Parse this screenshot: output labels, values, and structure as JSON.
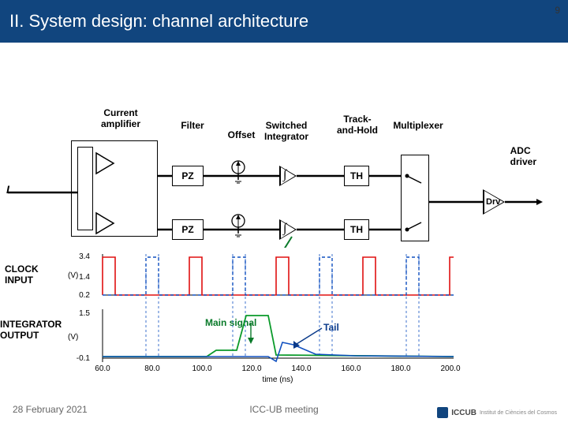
{
  "slide_number": "9",
  "title": "II. System design: channel architecture",
  "diagram": {
    "input_label": "I",
    "stages": {
      "amp": "Current\namplifier",
      "filter": "Filter",
      "offset": "Offset",
      "integrator": "Switched\nIntegrator",
      "trackhold": "Track-\nand-Hold",
      "mux": "Multiplexer"
    },
    "blocks": {
      "pz": "PZ",
      "th": "TH",
      "drv": "Drv"
    },
    "integral_symbol": "∫",
    "adc_driver": "ADC\ndriver"
  },
  "plots": {
    "clock_label": "CLOCK\nINPUT",
    "integrator_label": "INTEGRATOR\nOUTPUT",
    "main_signal_label": "Main signal",
    "tail_label": "Tail",
    "x_axis_label": "time (ns)",
    "x_ticks": [
      "60.0",
      "80.0",
      "100.0",
      "120.0",
      "140.0",
      "160.0",
      "180.0",
      "200.0"
    ],
    "y_ticks_upper": [
      "0.2",
      "1.4",
      "3.4"
    ],
    "y_ticks_lower": [
      "-0.1",
      "1.5"
    ],
    "y_unit": "(V)"
  },
  "chart_data": [
    {
      "type": "line",
      "title": "CLOCK INPUT",
      "xlabel": "time (ns)",
      "ylabel": "(V)",
      "ylim": [
        0.2,
        3.4
      ],
      "xlim": [
        60,
        200
      ],
      "series": [
        {
          "name": "clock_red",
          "x": [
            60,
            60,
            65,
            65,
            95,
            95,
            100,
            100,
            130,
            130,
            135,
            135,
            165,
            165,
            170,
            170,
            200
          ],
          "y": [
            0.2,
            3.4,
            3.4,
            0.2,
            0.2,
            3.4,
            3.4,
            0.2,
            0.2,
            3.4,
            3.4,
            0.2,
            0.2,
            3.4,
            3.4,
            0.2,
            0.2
          ]
        },
        {
          "name": "clock_blue_dashed",
          "x": [
            60,
            78,
            78,
            83,
            83,
            113,
            113,
            118,
            118,
            148,
            148,
            153,
            153,
            183,
            183,
            188,
            188,
            200
          ],
          "y": [
            0.2,
            0.2,
            3.4,
            3.4,
            0.2,
            0.2,
            3.4,
            3.4,
            0.2,
            0.2,
            3.4,
            3.4,
            0.2,
            0.2,
            3.4,
            3.4,
            0.2,
            0.2
          ]
        }
      ]
    },
    {
      "type": "line",
      "title": "INTEGRATOR OUTPUT",
      "xlabel": "time (ns)",
      "ylabel": "(V)",
      "ylim": [
        -0.1,
        1.5
      ],
      "xlim": [
        60,
        200
      ],
      "annotations": [
        "Main signal",
        "Tail"
      ],
      "series": [
        {
          "name": "green_pulse",
          "x": [
            60,
            102,
            106,
            114,
            118,
            127,
            130,
            200
          ],
          "y": [
            0,
            0,
            0.2,
            0.2,
            1.4,
            1.4,
            0.05,
            0.0
          ]
        },
        {
          "name": "blue_tail",
          "x": [
            60,
            127,
            130,
            135,
            140,
            160,
            200
          ],
          "y": [
            0,
            0,
            -0.08,
            0.35,
            0.28,
            0.02,
            0
          ]
        }
      ]
    }
  ],
  "footer": {
    "date": "28 February 2021",
    "meeting": "ICC-UB meeting",
    "logo_text": "ICCUB",
    "logo_sub": "Institut de Ciències del Cosmos"
  }
}
